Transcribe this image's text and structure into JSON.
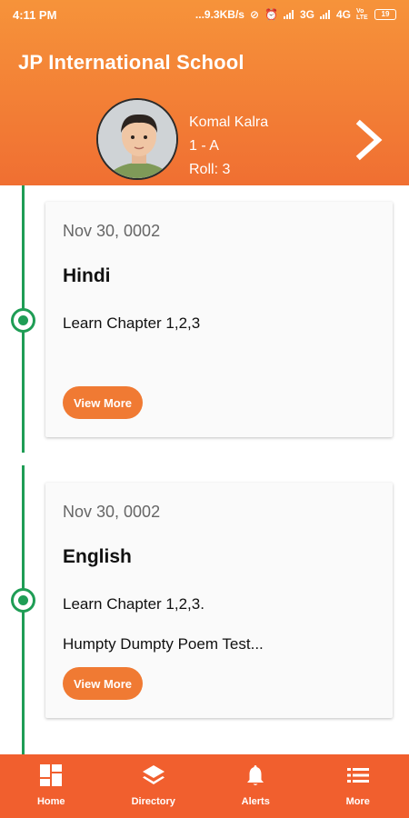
{
  "status_bar": {
    "time": "4:11 PM",
    "speed": "...9.3KB/s",
    "network1": "3G",
    "network2": "4G",
    "volte": "Vo LTE",
    "battery": "19"
  },
  "header": {
    "title": "JP International School",
    "student": {
      "name": "Komal Kalra",
      "class": "1 - A",
      "roll": "Roll: 3"
    },
    "next_icon": "chevron-right-icon"
  },
  "cards": [
    {
      "date": "Nov 30, 0002",
      "subject": "Hindi",
      "lines": [
        "Learn Chapter 1,2,3"
      ],
      "button": "View More"
    },
    {
      "date": "Nov 30, 0002",
      "subject": "English",
      "lines": [
        "Learn Chapter 1,2,3.",
        "Humpty Dumpty Poem Test..."
      ],
      "button": "View More"
    }
  ],
  "bottom_nav": [
    {
      "label": "Home",
      "icon": "home-grid-icon"
    },
    {
      "label": "Directory",
      "icon": "layers-icon"
    },
    {
      "label": "Alerts",
      "icon": "bell-icon"
    },
    {
      "label": "More",
      "icon": "list-icon"
    }
  ],
  "colors": {
    "header_top": "#f6933a",
    "header_bottom": "#f06f32",
    "accent": "#f07a33",
    "timeline": "#1f9d55",
    "nav": "#f15f2e"
  }
}
